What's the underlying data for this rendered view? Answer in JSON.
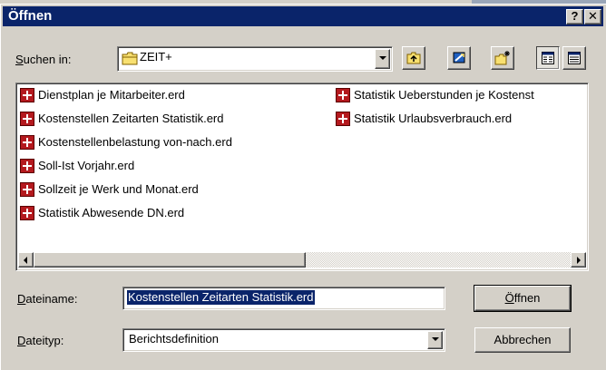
{
  "dialog": {
    "title": "Öffnen"
  },
  "titlebar": {
    "help_label": "?",
    "close_label": "✕"
  },
  "look_in": {
    "label_prefix": "S",
    "label_rest": "uchen in:",
    "value": "ZEIT+",
    "icon": "folder-icon"
  },
  "toolbar": {
    "buttons": [
      {
        "name": "up-one-level",
        "icon": "folder-up-icon"
      },
      {
        "name": "desktop",
        "icon": "desktop-icon"
      },
      {
        "name": "new-folder",
        "icon": "new-folder-icon"
      },
      {
        "name": "list-view",
        "icon": "list-view-icon"
      },
      {
        "name": "details-view",
        "icon": "details-view-icon"
      }
    ]
  },
  "files": [
    {
      "name": "Dienstplan je Mitarbeiter.erd",
      "icon": "report-file-icon"
    },
    {
      "name": "Kostenstellen Zeitarten Statistik.erd",
      "icon": "report-file-icon"
    },
    {
      "name": "Kostenstellenbelastung von-nach.erd",
      "icon": "report-file-icon"
    },
    {
      "name": "Soll-Ist Vorjahr.erd",
      "icon": "report-file-icon"
    },
    {
      "name": "Sollzeit je Werk und Monat.erd",
      "icon": "report-file-icon"
    },
    {
      "name": "Statistik Abwesende DN.erd",
      "icon": "report-file-icon"
    },
    {
      "name": "Statistik Ueberstunden je Kostenst",
      "icon": "report-file-icon"
    },
    {
      "name": "Statistik Urlaubsverbrauch.erd",
      "icon": "report-file-icon"
    }
  ],
  "filename": {
    "label_prefix": "D",
    "label_rest": "ateiname:",
    "value": "Kostenstellen Zeitarten Statistik.erd"
  },
  "filetype": {
    "label_prefix": "D",
    "label_rest": "ateityp:",
    "value": "Berichtsdefinition"
  },
  "buttons": {
    "open_prefix": "Ö",
    "open_rest": "ffnen",
    "cancel_label": "Abbrechen"
  },
  "colors": {
    "titlebar": "#0a246a",
    "face": "#d4d0c8",
    "selection": "#0a246a",
    "file_icon": "#b4191e"
  }
}
